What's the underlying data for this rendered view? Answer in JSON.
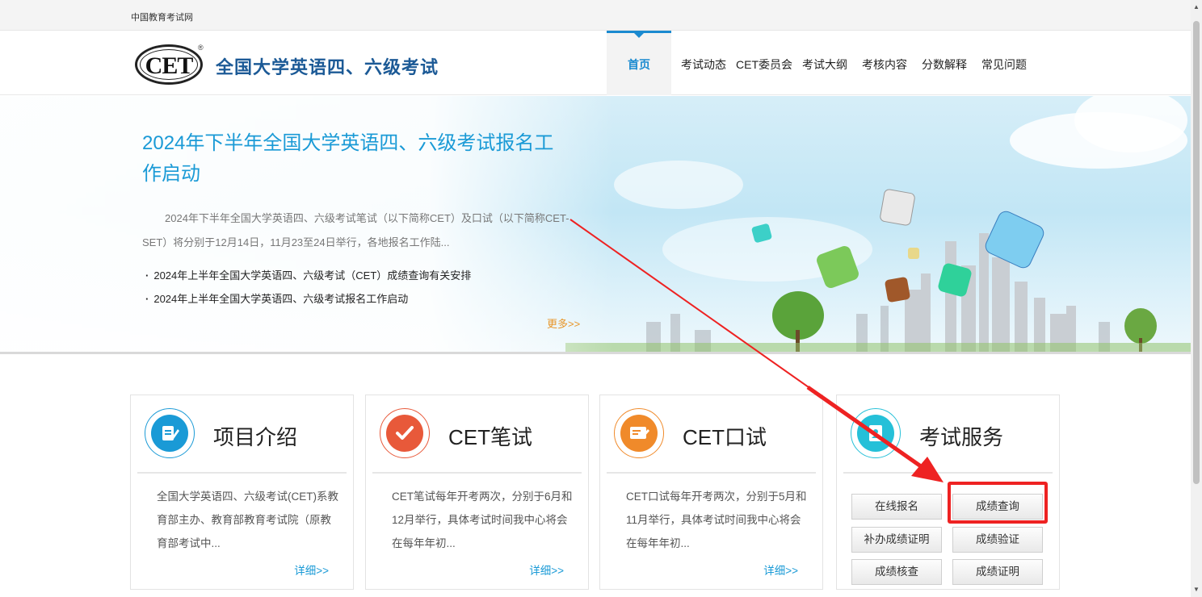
{
  "topbar": {
    "site_name": "中国教育考试网"
  },
  "header": {
    "logo_text": "CET",
    "logo_reg": "®",
    "title": "全国大学英语四、六级考试",
    "nav": [
      {
        "label": "首页",
        "active": true
      },
      {
        "label": "考试动态"
      },
      {
        "label": "CET委员会"
      },
      {
        "label": "考试大纲"
      },
      {
        "label": "考核内容"
      },
      {
        "label": "分数解释"
      },
      {
        "label": "常见问题"
      }
    ]
  },
  "banner": {
    "headline": "2024年下半年全国大学英语四、六级考试报名工作启动",
    "summary": "2024年下半年全国大学英语四、六级考试笔试（以下简称CET）及口试（以下简称CET-SET）将分别于12月14日，11月23至24日举行，各地报名工作陆...",
    "links": [
      "2024年上半年全国大学英语四、六级考试（CET）成绩查询有关安排",
      "2024年上半年全国大学英语四、六级考试报名工作启动"
    ],
    "more": "更多>>"
  },
  "cards": [
    {
      "title": "项目介绍",
      "icon": "document-edit-icon",
      "color": "#1a9ad6",
      "desc": "全国大学英语四、六级考试(CET)系教育部主办、教育部教育考试院（原教育部考试中...",
      "detail": "详细>>"
    },
    {
      "title": "CET笔试",
      "icon": "checkmark-icon",
      "color": "#e8593a",
      "desc": "CET笔试每年开考两次，分别于6月和12月举行，具体考试时间我中心将会在每年年初...",
      "detail": "详细>>"
    },
    {
      "title": "CET口试",
      "icon": "screen-pen-icon",
      "color": "#f08a2a",
      "desc": "CET口试每年开考两次，分别于5月和11月举行，具体考试时间我中心将会在每年年初...",
      "detail": "详细>>"
    },
    {
      "title": "考试服务",
      "icon": "contact-book-icon",
      "color": "#25c0d8",
      "services": [
        "在线报名",
        "成绩查询",
        "补办成绩证明",
        "成绩验证",
        "成绩核查",
        "成绩证明"
      ]
    }
  ],
  "colors": {
    "brand_blue": "#1a9ad6",
    "title_blue": "#1c5a96",
    "annotation_red": "#ee2222",
    "more_orange": "#e8962a"
  }
}
